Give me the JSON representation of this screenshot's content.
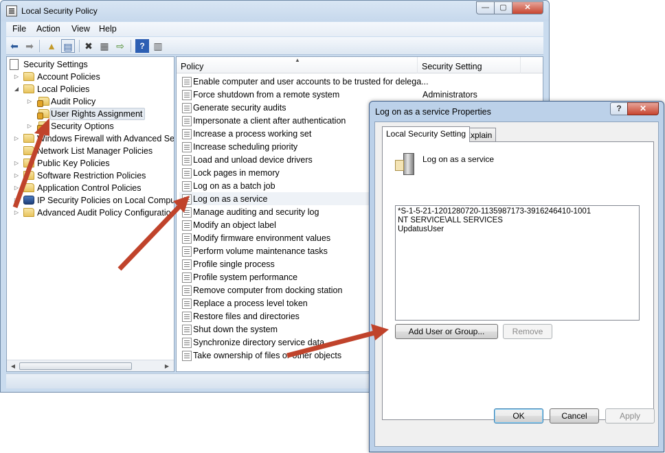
{
  "main_window": {
    "title": "Local Security Policy",
    "controls": {
      "minimize": "—",
      "maximize": "▢",
      "close": "✕"
    }
  },
  "menu": [
    "File",
    "Action",
    "View",
    "Help"
  ],
  "tree": {
    "items": [
      {
        "label": "Security Settings",
        "expander": "",
        "icon": "security-settings-icon"
      },
      {
        "label": "Account Policies",
        "expander": "▷",
        "icon": "folder-icon"
      },
      {
        "label": "Local Policies",
        "expander": "◢",
        "icon": "folder-icon"
      },
      {
        "label": "Audit Policy",
        "expander": "▷",
        "icon": "folder-icon"
      },
      {
        "label": "User Rights Assignment",
        "expander": "",
        "icon": "folder-icon"
      },
      {
        "label": "Security Options",
        "expander": "▷",
        "icon": "folder-icon"
      },
      {
        "label": "Windows Firewall with Advanced Secu",
        "expander": "▷",
        "icon": "folder-icon"
      },
      {
        "label": "Network List Manager Policies",
        "expander": "",
        "icon": "folder-icon"
      },
      {
        "label": "Public Key Policies",
        "expander": "▷",
        "icon": "folder-icon"
      },
      {
        "label": "Software Restriction Policies",
        "expander": "▷",
        "icon": "folder-icon"
      },
      {
        "label": "Application Control Policies",
        "expander": "▷",
        "icon": "folder-icon"
      },
      {
        "label": "IP Security Policies on Local Compute",
        "expander": "▷",
        "icon": "ip-security-icon"
      },
      {
        "label": "Advanced Audit Policy Configuratio",
        "expander": "▷",
        "icon": "folder-icon"
      }
    ]
  },
  "list": {
    "columns": [
      "Policy",
      "Security Setting"
    ],
    "rows": [
      {
        "policy": "Enable computer and user accounts to be trusted for delega...",
        "setting": ""
      },
      {
        "policy": "Force shutdown from a remote system",
        "setting": "Administrators"
      },
      {
        "policy": "Generate security audits",
        "setting": ""
      },
      {
        "policy": "Impersonate a client after authentication",
        "setting": ""
      },
      {
        "policy": "Increase a process working set",
        "setting": ""
      },
      {
        "policy": "Increase scheduling priority",
        "setting": ""
      },
      {
        "policy": "Load and unload device drivers",
        "setting": ""
      },
      {
        "policy": "Lock pages in memory",
        "setting": ""
      },
      {
        "policy": "Log on as a batch job",
        "setting": ""
      },
      {
        "policy": "Log on as a service",
        "setting": ""
      },
      {
        "policy": "Manage auditing and security log",
        "setting": ""
      },
      {
        "policy": "Modify an object label",
        "setting": ""
      },
      {
        "policy": "Modify firmware environment values",
        "setting": ""
      },
      {
        "policy": "Perform volume maintenance tasks",
        "setting": ""
      },
      {
        "policy": "Profile single process",
        "setting": ""
      },
      {
        "policy": "Profile system performance",
        "setting": ""
      },
      {
        "policy": "Remove computer from docking station",
        "setting": ""
      },
      {
        "policy": "Replace a process level token",
        "setting": ""
      },
      {
        "policy": "Restore files and directories",
        "setting": ""
      },
      {
        "policy": "Shut down the system",
        "setting": ""
      },
      {
        "policy": "Synchronize directory service data",
        "setting": ""
      },
      {
        "policy": "Take ownership of files or other objects",
        "setting": ""
      }
    ]
  },
  "dialog": {
    "title": "Log on as a service Properties",
    "help": "?",
    "close": "✕",
    "tabs": [
      "Local Security Setting",
      "Explain"
    ],
    "policy_name": "Log on as a service",
    "principals": [
      "*S-1-5-21-1201280720-1135987173-3916246410-1001",
      "NT SERVICE\\ALL SERVICES",
      "UpdatusUser"
    ],
    "add_button": "Add User or Group...",
    "remove_button": "Remove",
    "ok_button": "OK",
    "cancel_button": "Cancel",
    "apply_button": "Apply"
  },
  "colors": {
    "annotation_arrow": "#c0432b",
    "window_frame": "#c9dbee"
  }
}
